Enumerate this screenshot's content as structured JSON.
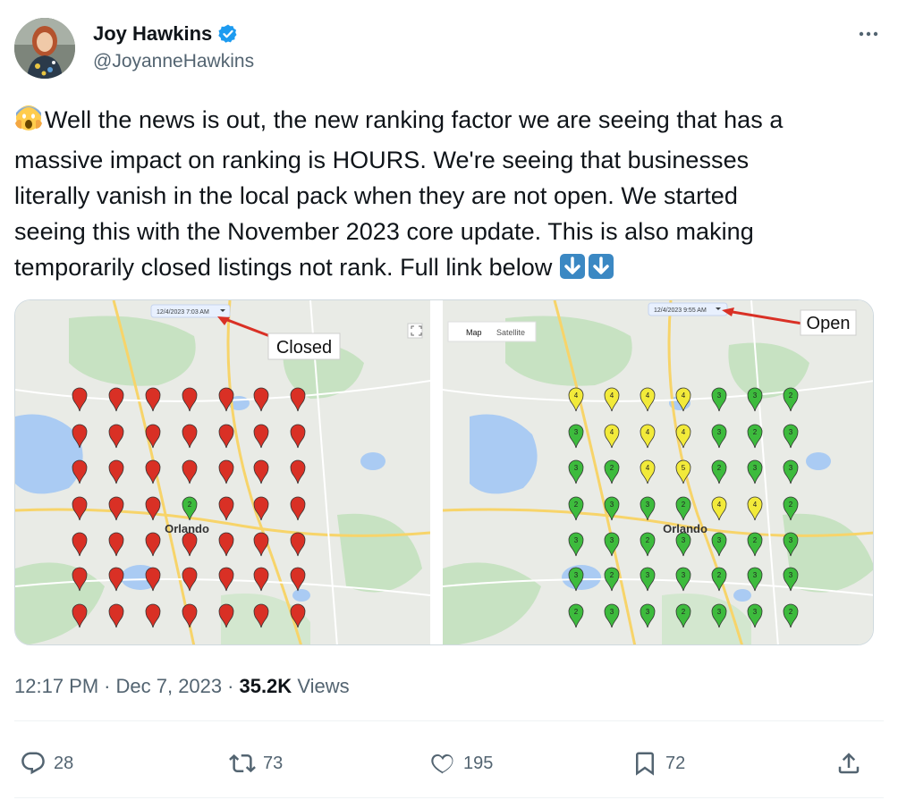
{
  "author": {
    "display_name": "Joy Hawkins",
    "handle": "@JoyanneHawkins",
    "verified": true,
    "verified_color": "#1d9bf0"
  },
  "more_icon": "more-horizontal-icon",
  "tweet": {
    "leading_emoji": "screaming-face-emoji",
    "text_line_1": "Well the news is out, the new ranking factor we are seeing that has a",
    "text_line_2": "massive impact on ranking is HOURS. We're seeing that businesses",
    "text_line_3": "literally vanish in the local pack when they are not open. We started",
    "text_line_4": "seeing this with the November 2023 core update. This is also making",
    "text_line_5": "temporarily closed listings not rank. Full link below",
    "trailing_emojis": [
      "down-arrow-emoji",
      "down-arrow-emoji"
    ]
  },
  "media": {
    "left_map": {
      "date_selector": "12/4/2023 7:03 AM",
      "annotation": "Closed",
      "city_label": "Orlando",
      "pin_color": "#d93025"
    },
    "right_map": {
      "date_selector": "12/4/2023 9:55 AM",
      "annotation": "Open",
      "city_label": "Orlando",
      "map_tab": "Map",
      "satellite_tab": "Satellite",
      "pin_color_green": "#3dbb3d",
      "pin_color_yellow": "#f2ea3a"
    }
  },
  "meta": {
    "time": "12:17 PM",
    "date": "Dec 7, 2023",
    "views_count": "35.2K",
    "views_label": "Views"
  },
  "actions": {
    "replies": "28",
    "reposts": "73",
    "likes": "195",
    "bookmarks": "72"
  }
}
